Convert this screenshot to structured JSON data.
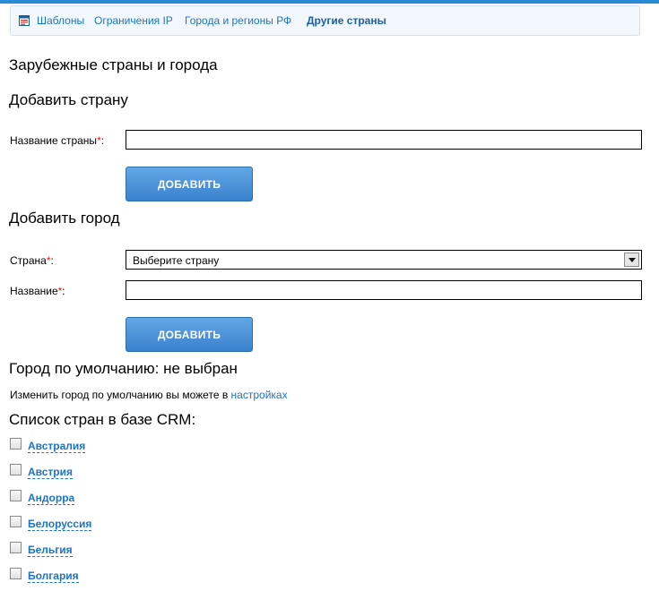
{
  "nav": {
    "items": [
      {
        "label": "Шаблоны",
        "active": false
      },
      {
        "label": "Ограничения IP",
        "active": false
      },
      {
        "label": "Города и регионы РФ",
        "active": false
      },
      {
        "label": "Другие страны",
        "active": true
      }
    ]
  },
  "page_title": "Зарубежные страны и города",
  "add_country": {
    "heading": "Добавить страну",
    "name_label": "Название страны",
    "required_mark": "*",
    "colon": ":",
    "name_value": "",
    "button_label": "ДОБАВИТЬ"
  },
  "add_city": {
    "heading": "Добавить город",
    "country_label": "Страна",
    "country_selected": "Выберите страну",
    "name_label": "Название",
    "required_mark": "*",
    "colon": ":",
    "name_value": "",
    "button_label": "ДОБАВИТЬ"
  },
  "default_city": {
    "heading": "Город по умолчанию: не выбран",
    "info_text": "Изменить город по умолчанию вы можете в ",
    "settings_link": "настройках"
  },
  "countries": {
    "heading": "Список стран в базе CRM:",
    "items": [
      {
        "name": "Австралия",
        "checked": false
      },
      {
        "name": "Австрия",
        "checked": false
      },
      {
        "name": "Андорра",
        "checked": false
      },
      {
        "name": "Белоруссия",
        "checked": false
      },
      {
        "name": "Бельгия",
        "checked": false
      },
      {
        "name": "Болгария",
        "checked": false
      }
    ]
  },
  "colors": {
    "accent": "#2a8ad6",
    "link": "#1c74c4",
    "required": "#e01b1b",
    "button_top": "#62a7e4",
    "button_bottom": "#3a82cf"
  }
}
